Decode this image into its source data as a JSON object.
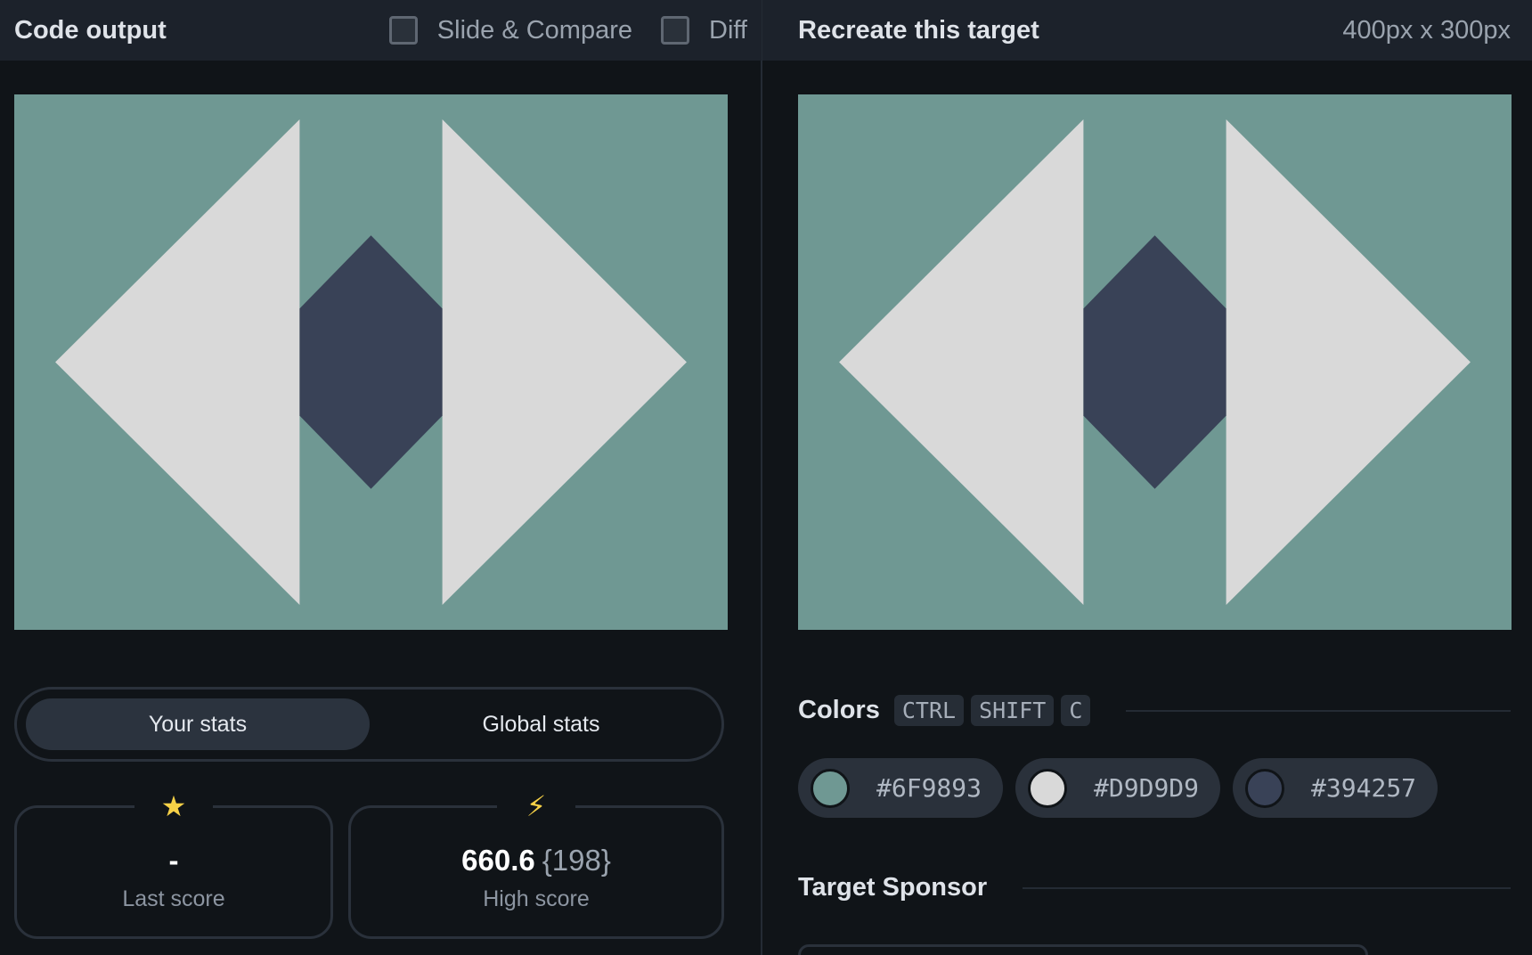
{
  "header": {
    "left_title": "Code output",
    "slide_compare_label": "Slide & Compare",
    "diff_label": "Diff",
    "right_title": "Recreate this target",
    "dimensions": "400px x 300px"
  },
  "stats": {
    "your_stats_label": "Your stats",
    "global_stats_label": "Global stats",
    "last_score": {
      "value": "-",
      "label": "Last score",
      "icon": "star-icon"
    },
    "high_score": {
      "value": "660.6",
      "sub": "{198}",
      "label": "High score",
      "icon": "lightning-icon"
    }
  },
  "colors_section": {
    "title": "Colors",
    "shortcut_keys": [
      "CTRL",
      "SHIFT",
      "C"
    ],
    "swatches": [
      {
        "hex": "#6F9893"
      },
      {
        "hex": "#D9D9D9"
      },
      {
        "hex": "#394257"
      }
    ]
  },
  "sponsor_section": {
    "title": "Target Sponsor"
  },
  "palette": {
    "background": "#6F9893",
    "light": "#D9D9D9",
    "dark": "#394257"
  }
}
